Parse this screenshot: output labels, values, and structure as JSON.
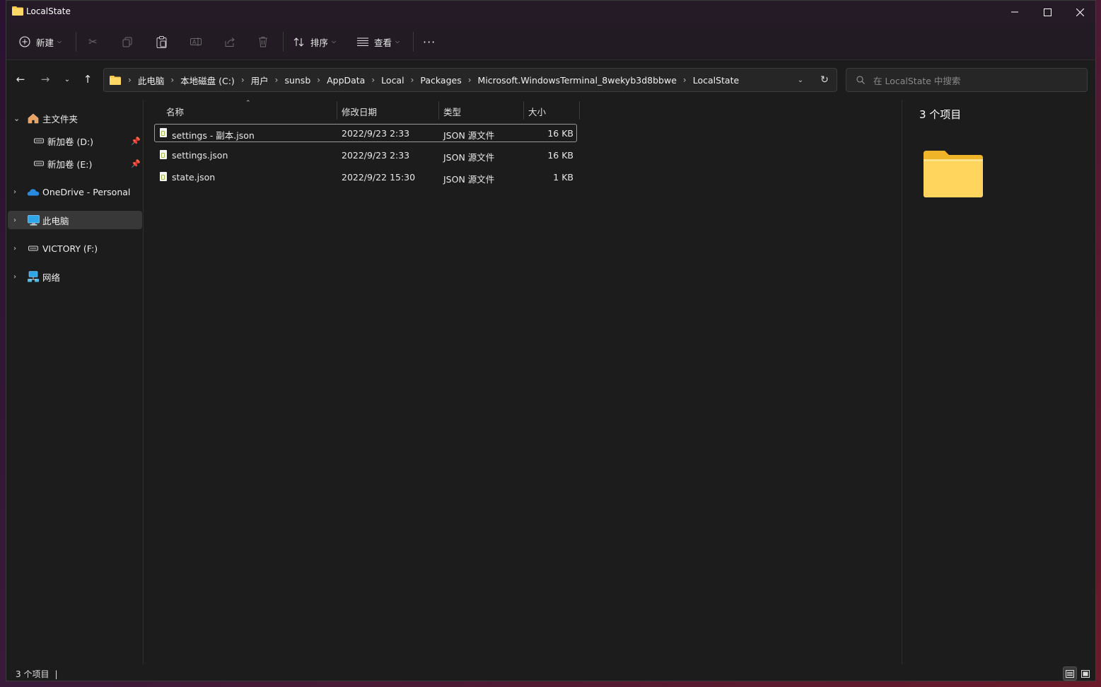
{
  "window": {
    "title": "LocalState"
  },
  "toolbar": {
    "new_label": "新建",
    "sort_label": "排序",
    "view_label": "查看",
    "more_label": "···"
  },
  "breadcrumb": [
    "此电脑",
    "本地磁盘 (C:)",
    "用户",
    "sunsb",
    "AppData",
    "Local",
    "Packages",
    "Microsoft.WindowsTerminal_8wekyb3d8bbwe",
    "LocalState"
  ],
  "search": {
    "placeholder": "在 LocalState 中搜索"
  },
  "sidebar": {
    "items": [
      {
        "label": "主文件夹",
        "icon": "home-icon"
      },
      {
        "label": "新加卷 (D:)",
        "icon": "drive-icon",
        "pinned": true
      },
      {
        "label": "新加卷 (E:)",
        "icon": "drive-icon",
        "pinned": true
      },
      {
        "label": "OneDrive - Personal",
        "icon": "onedrive-icon"
      },
      {
        "label": "此电脑",
        "icon": "pc-icon",
        "selected": true
      },
      {
        "label": "VICTORY (F:)",
        "icon": "drive-icon"
      },
      {
        "label": "网络",
        "icon": "network-icon"
      }
    ]
  },
  "columns": {
    "name": "名称",
    "modified": "修改日期",
    "type": "类型",
    "size": "大小"
  },
  "files": [
    {
      "name": "settings - 副本.json",
      "modified": "2022/9/23 2:33",
      "type": "JSON 源文件",
      "size": "16 KB"
    },
    {
      "name": "settings.json",
      "modified": "2022/9/23 2:33",
      "type": "JSON 源文件",
      "size": "16 KB"
    },
    {
      "name": "state.json",
      "modified": "2022/9/22 15:30",
      "type": "JSON 源文件",
      "size": "1 KB"
    }
  ],
  "details": {
    "title": "3 个项目"
  },
  "status": {
    "text": "3 个项目"
  },
  "colors": {
    "folder": "#f7c948",
    "accent": "#4cc2ff"
  }
}
